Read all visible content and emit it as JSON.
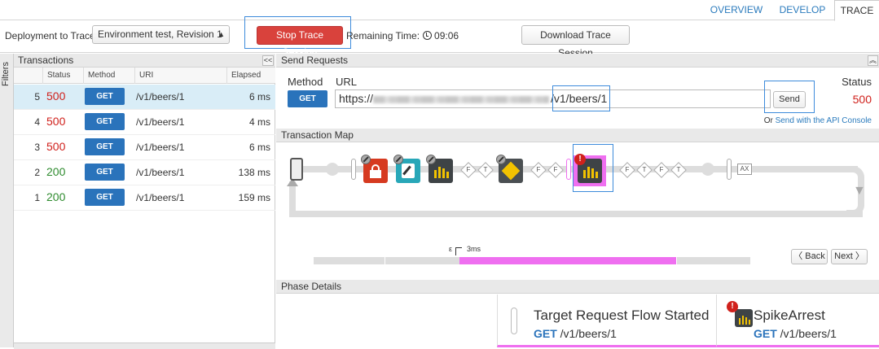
{
  "top_tabs": [
    "OVERVIEW",
    "DEVELOP",
    "TRACE"
  ],
  "toolbar": {
    "deployment_label": "Deployment to Trace",
    "deployment_value": "Environment test, Revision 1",
    "stop_label": "Stop Trace Session",
    "remaining_label": "Remaining Time:",
    "remaining_time": "09:06",
    "download_label": "Download Trace Session"
  },
  "filters_label": "Filters",
  "transactions": {
    "title": "Transactions",
    "collapse_glyph": "<<",
    "columns": [
      "Status",
      "Method",
      "URI",
      "Elapsed"
    ],
    "rows": [
      {
        "num": "5",
        "status": "500",
        "method": "GET",
        "uri": "/v1/beers/1",
        "elapsed": "6 ms",
        "selected": true
      },
      {
        "num": "4",
        "status": "500",
        "method": "GET",
        "uri": "/v1/beers/1",
        "elapsed": "4 ms"
      },
      {
        "num": "3",
        "status": "500",
        "method": "GET",
        "uri": "/v1/beers/1",
        "elapsed": "6 ms"
      },
      {
        "num": "2",
        "status": "200",
        "method": "GET",
        "uri": "/v1/beers/1",
        "elapsed": "138 ms"
      },
      {
        "num": "1",
        "status": "200",
        "method": "GET",
        "uri": "/v1/beers/1",
        "elapsed": "159 ms"
      }
    ]
  },
  "send_requests": {
    "title": "Send Requests",
    "method_label": "Method",
    "url_label": "URL",
    "status_label": "Status",
    "method_value": "GET",
    "url_prefix": "https://",
    "url_path": "/v1/beers/1",
    "send_label": "Send",
    "status_value": "500",
    "console_prefix": "Or",
    "console_link": "Send with the API Console"
  },
  "transaction_map": {
    "title": "Transaction Map",
    "flow_labels": [
      "F",
      "T",
      "F",
      "F",
      "F",
      "T",
      "F",
      "T"
    ],
    "ax_label": "AX",
    "timeline_label_a": "ε",
    "timeline_label_b": "3ms",
    "back_label": "Back",
    "next_label": "Next"
  },
  "phase_details": {
    "title": "Phase Details",
    "items": [
      {
        "title": "Target Request Flow Started",
        "method": "GET",
        "path": "/v1/beers/1"
      },
      {
        "title": "SpikeArrest",
        "method": "GET",
        "path": "/v1/beers/1"
      }
    ]
  },
  "colors": {
    "accent_blue": "#2a73bb",
    "error_red": "#d0211c",
    "success_green": "#2e8b2e",
    "highlight_pink": "#ef6ff0"
  }
}
